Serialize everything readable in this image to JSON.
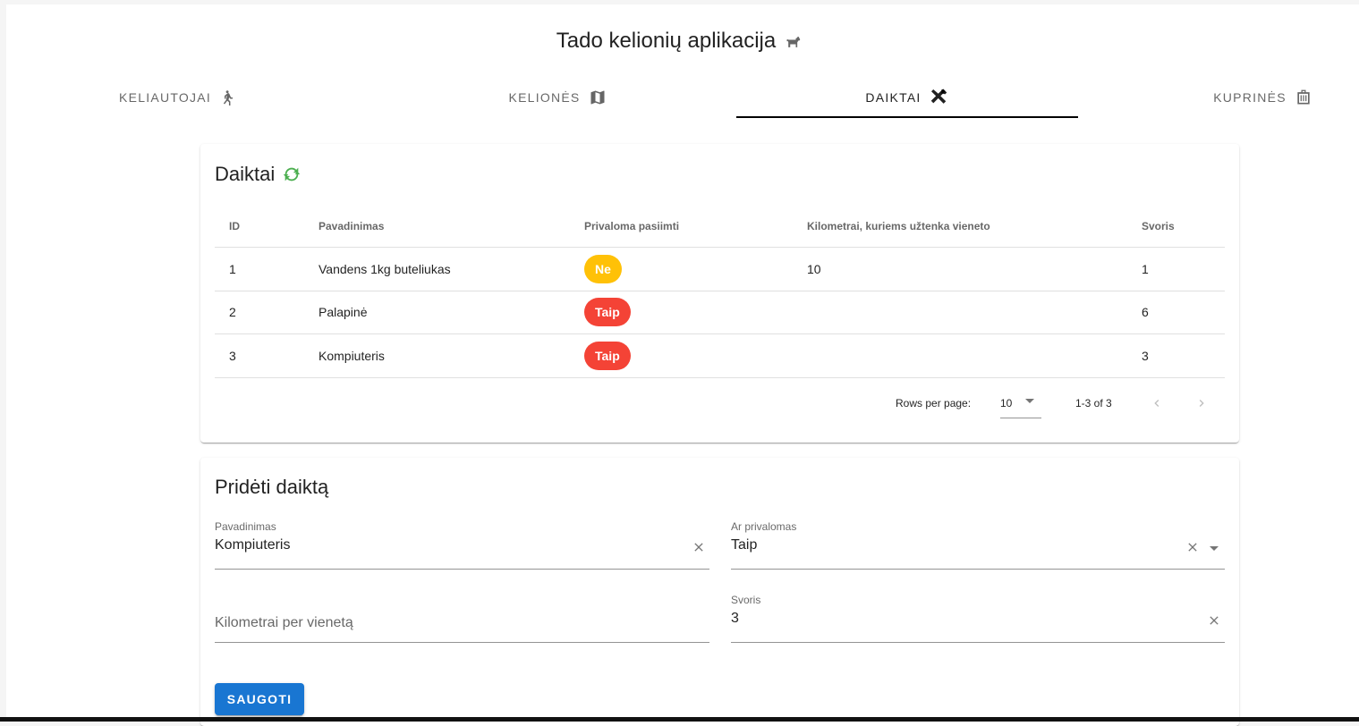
{
  "app": {
    "title": "Tado kelionių aplikacija",
    "title_icon": "dog-icon"
  },
  "tabs": [
    {
      "label": "Keliautojai",
      "icon": "walk-icon",
      "active": false
    },
    {
      "label": "Kelionės",
      "icon": "map-icon",
      "active": false
    },
    {
      "label": "Daiktai",
      "icon": "tools-icon",
      "active": true
    },
    {
      "label": "Kuprinės",
      "icon": "bag-icon",
      "active": false
    }
  ],
  "items_card": {
    "title": "Daiktai",
    "refresh_icon": "refresh-icon",
    "columns": [
      "ID",
      "Pavadinimas",
      "Privaloma pasiimti",
      "Kilometrai, kuriems užtenka vieneto",
      "Svoris"
    ],
    "rows": [
      {
        "id": "1",
        "name": "Vandens 1kg buteliukas",
        "required": "Ne",
        "km": "10",
        "weight": "1"
      },
      {
        "id": "2",
        "name": "Palapinė",
        "required": "Taip",
        "km": "",
        "weight": "6"
      },
      {
        "id": "3",
        "name": "Kompiuteris",
        "required": "Taip",
        "km": "",
        "weight": "3"
      }
    ],
    "footer": {
      "rows_per_page_label": "Rows per page:",
      "rows_per_page": "10",
      "range": "1-3 of 3"
    }
  },
  "form_card": {
    "title": "Pridėti daiktą",
    "name_field": {
      "label": "Pavadinimas",
      "value": "Kompiuteris"
    },
    "required_field": {
      "label": "Ar privalomas",
      "value": "Taip"
    },
    "km_field": {
      "placeholder": "Kilometrai per vienetą",
      "value": ""
    },
    "weight_field": {
      "label": "Svoris",
      "value": "3"
    },
    "save_label": "SAUGOTI"
  },
  "colors": {
    "chip_no": "#ffc107",
    "chip_yes": "#f44336",
    "primary": "#1976d2",
    "refresh": "#4caf50"
  }
}
